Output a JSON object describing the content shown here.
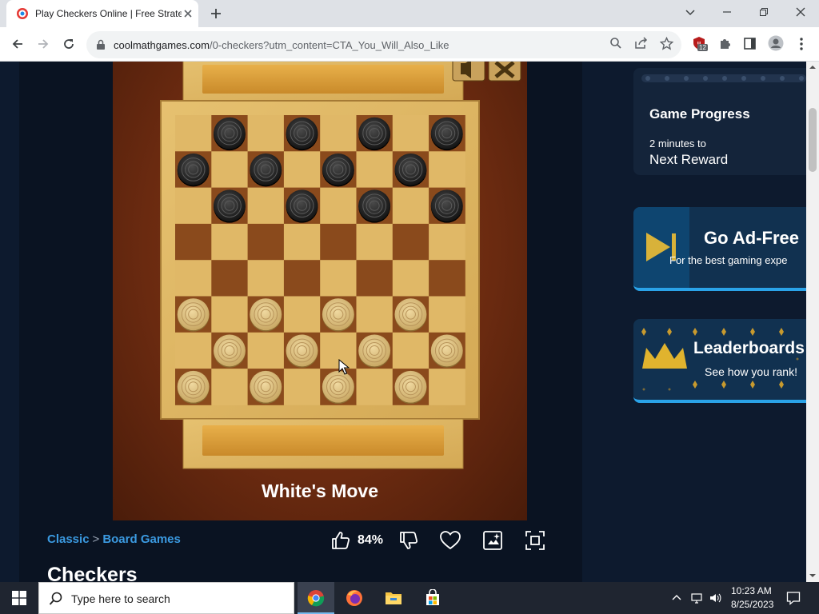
{
  "browser": {
    "tab_title": "Play Checkers Online | Free Strate",
    "url_domain": "coolmathgames.com",
    "url_path": "/0-checkers?utm_content=CTA_You_Will_Also_Like",
    "extension_badge": "12"
  },
  "game": {
    "status": "White's Move",
    "board": {
      "size": 8,
      "dark_pieces": [
        [
          0,
          1
        ],
        [
          0,
          3
        ],
        [
          0,
          5
        ],
        [
          0,
          7
        ],
        [
          1,
          0
        ],
        [
          1,
          2
        ],
        [
          1,
          4
        ],
        [
          1,
          6
        ],
        [
          2,
          1
        ],
        [
          2,
          3
        ],
        [
          2,
          5
        ],
        [
          2,
          7
        ]
      ],
      "light_pieces": [
        [
          5,
          0
        ],
        [
          5,
          2
        ],
        [
          5,
          4
        ],
        [
          5,
          6
        ],
        [
          6,
          1
        ],
        [
          6,
          3
        ],
        [
          6,
          5
        ],
        [
          6,
          7
        ],
        [
          7,
          0
        ],
        [
          7,
          2
        ],
        [
          7,
          4
        ],
        [
          7,
          6
        ]
      ]
    }
  },
  "info_bar": {
    "breadcrumb": [
      "Classic",
      "Board Games"
    ],
    "breadcrumb_sep": ">",
    "rating": "84%",
    "title": "Checkers"
  },
  "sidebar": {
    "progress": {
      "title": "Game Progress",
      "subtitle": "2 minutes to",
      "reward": "Next Reward"
    },
    "adfree": {
      "title": "Go Ad-Free",
      "subtitle": "For the best gaming expe"
    },
    "leaderboard": {
      "title": "Leaderboards",
      "subtitle": "See how you rank!"
    }
  },
  "taskbar": {
    "search_placeholder": "Type here to search",
    "time": "10:23 AM",
    "date": "8/25/2023"
  },
  "colors": {
    "accent_blue": "#3b9ae1",
    "page_bg": "#0d1a2e",
    "board_dark": "#8a4a1c",
    "board_light": "#e0b867"
  }
}
